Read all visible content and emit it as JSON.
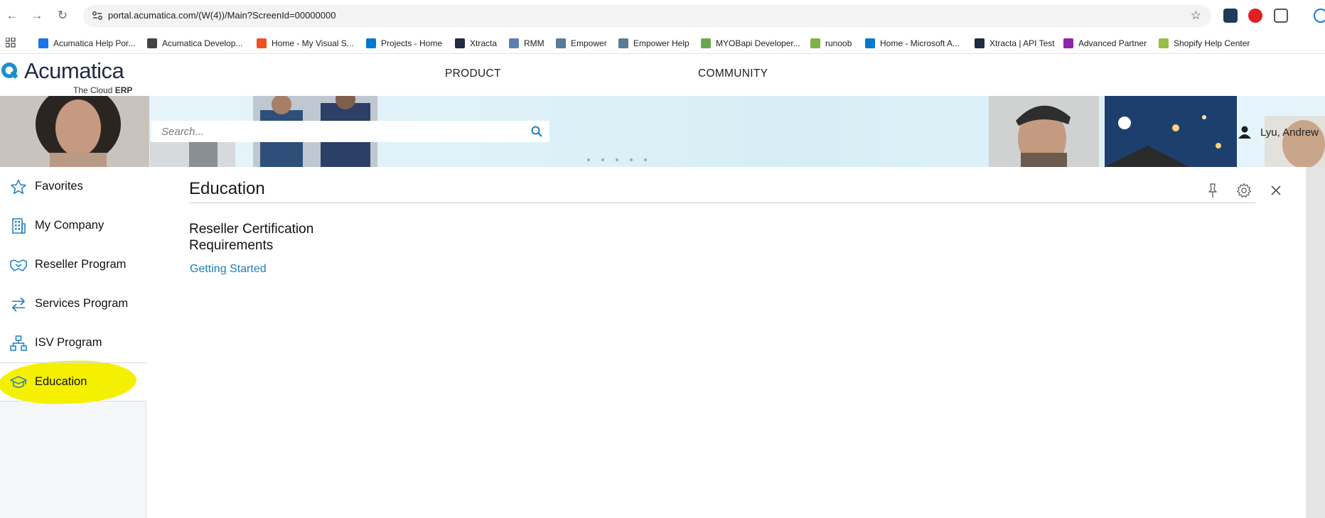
{
  "browser": {
    "url": "portal.acumatica.com/(W(4))/Main?ScreenId=00000000",
    "bookmarks": [
      {
        "label": "Acumatica Help Por...",
        "color": "#1a73e8"
      },
      {
        "label": "Acumatica Develop...",
        "color": "#444444"
      },
      {
        "label": "Home - My Visual S...",
        "color": "#f25022"
      },
      {
        "label": "Projects - Home",
        "color": "#0078d4"
      },
      {
        "label": "Xtracta",
        "color": "#1f2a44"
      },
      {
        "label": "RMM",
        "color": "#5b7fb0"
      },
      {
        "label": "Empower",
        "color": "#5a7c96"
      },
      {
        "label": "Empower Help",
        "color": "#5a7c96"
      },
      {
        "label": "MYOBapi Developer...",
        "color": "#6aa84f"
      },
      {
        "label": "runoob",
        "color": "#7cb342"
      },
      {
        "label": "Home - Microsoft A...",
        "color": "#0078d4"
      },
      {
        "label": "Xtracta | API Test",
        "color": "#1f2a44"
      },
      {
        "label": "Advanced Partner",
        "color": "#8e24aa"
      },
      {
        "label": "Shopify Help Center",
        "color": "#95bf47"
      }
    ]
  },
  "header": {
    "logo_text": "Acumatica",
    "logo_sub_prefix": "The Cloud ",
    "logo_sub_bold": "ERP",
    "nav": [
      "PRODUCT",
      "COMMUNITY"
    ]
  },
  "banner": {
    "search_placeholder": "Search...",
    "user_name": "Lyu, Andrew"
  },
  "sidebar": {
    "items": [
      {
        "label": "Favorites",
        "icon": "star-icon"
      },
      {
        "label": "My Company",
        "icon": "building-icon"
      },
      {
        "label": "Reseller Program",
        "icon": "handshake-icon"
      },
      {
        "label": "Services Program",
        "icon": "arrows-icon"
      },
      {
        "label": "ISV Program",
        "icon": "hierarchy-icon"
      },
      {
        "label": "Education",
        "icon": "graduation-cap-icon"
      }
    ]
  },
  "main": {
    "title": "Education",
    "section_title": "Reseller Certification Requirements",
    "link": "Getting Started"
  },
  "colors": {
    "accent": "#1a7fbf",
    "highlight": "#f4f000"
  }
}
